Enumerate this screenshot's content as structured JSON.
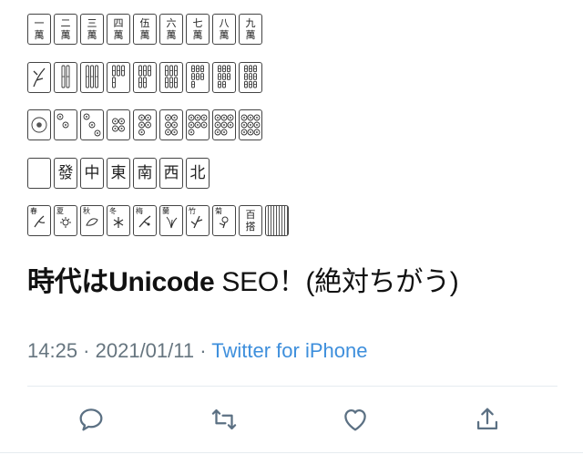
{
  "tiles": {
    "characters": [
      {
        "top": "一",
        "bottom": "萬"
      },
      {
        "top": "二",
        "bottom": "萬"
      },
      {
        "top": "三",
        "bottom": "萬"
      },
      {
        "top": "四",
        "bottom": "萬"
      },
      {
        "top": "伍",
        "bottom": "萬"
      },
      {
        "top": "六",
        "bottom": "萬"
      },
      {
        "top": "七",
        "bottom": "萬"
      },
      {
        "top": "八",
        "bottom": "萬"
      },
      {
        "top": "九",
        "bottom": "萬"
      }
    ],
    "bamboo_counts": [
      1,
      2,
      3,
      4,
      5,
      6,
      7,
      8,
      9
    ],
    "circle_counts": [
      1,
      2,
      3,
      4,
      5,
      6,
      7,
      8,
      9
    ],
    "honors": [
      "",
      "發",
      "中",
      "東",
      "南",
      "西",
      "北"
    ],
    "flowers": [
      "春",
      "夏",
      "秋",
      "冬",
      "梅",
      "蘭",
      "竹",
      "菊"
    ],
    "joker": {
      "top": "百",
      "bottom": "搭"
    }
  },
  "tweet": {
    "text_bold": "時代はUnicode",
    "text_rest": " SEO！(絶対ちがう)",
    "time": "14:25",
    "separator1": " · ",
    "date": "2021/01/11",
    "separator2": " · ",
    "source": "Twitter for iPhone"
  },
  "actions": [
    {
      "name": "reply",
      "icon": "reply-icon"
    },
    {
      "name": "retweet",
      "icon": "retweet-icon"
    },
    {
      "name": "like",
      "icon": "heart-icon"
    },
    {
      "name": "share",
      "icon": "share-icon"
    }
  ],
  "colors": {
    "text": "#111111",
    "meta": "#66757f",
    "link": "#3e8fdc",
    "icon": "#5b7083",
    "divider": "#e6ecf0"
  }
}
